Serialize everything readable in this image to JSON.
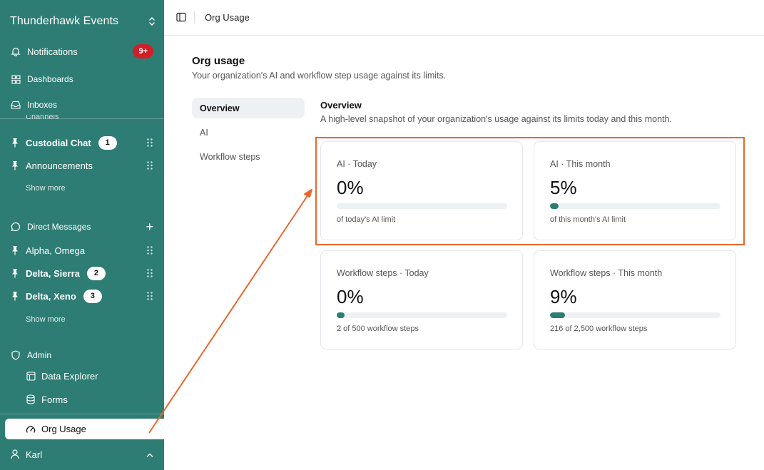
{
  "workspace": {
    "name": "Thunderhawk Events"
  },
  "nav": {
    "notifications": {
      "label": "Notifications",
      "badge": "9+"
    },
    "dashboards": {
      "label": "Dashboards"
    },
    "inboxes": {
      "label": "Inboxes"
    },
    "channels_label": "Channels"
  },
  "channels": {
    "items": [
      {
        "label": "Custodial Chat",
        "count": "1"
      },
      {
        "label": "Announcements"
      }
    ],
    "show_more": "Show more"
  },
  "direct_messages": {
    "label": "Direct Messages",
    "items": [
      {
        "label": "Alpha, Omega"
      },
      {
        "label": "Delta, Sierra",
        "count": "2"
      },
      {
        "label": "Delta, Xeno",
        "count": "3"
      }
    ],
    "show_more": "Show more"
  },
  "admin": {
    "label": "Admin",
    "items": [
      {
        "label": "Data Explorer"
      },
      {
        "label": "Forms"
      },
      {
        "label": "Org Usage"
      }
    ]
  },
  "user": {
    "name": "Karl"
  },
  "topbar": {
    "title": "Org Usage"
  },
  "page": {
    "title": "Org usage",
    "subtitle": "Your organization's AI and workflow step usage against its limits."
  },
  "tabs": [
    {
      "label": "Overview",
      "active": true
    },
    {
      "label": "AI"
    },
    {
      "label": "Workflow steps"
    }
  ],
  "overview": {
    "title": "Overview",
    "subtitle": "A high-level snapshot of your organization's usage against its limits today and this month."
  },
  "cards": [
    {
      "label": "AI · Today",
      "value": "0%",
      "progress": 0,
      "note": "of today's AI limit"
    },
    {
      "label": "AI · This month",
      "value": "5%",
      "progress": 0.05,
      "note": "of this month's AI limit"
    },
    {
      "label": "Workflow steps · Today",
      "value": "0%",
      "progress": 0.004,
      "note": "2 of 500 workflow steps"
    },
    {
      "label": "Workflow steps · This month",
      "value": "9%",
      "progress": 0.0864,
      "note": "216 of 2,500 workflow steps"
    }
  ],
  "colors": {
    "sidebar": "#2e7d74",
    "accent": "#2e7d74",
    "badge": "#d11f2a",
    "annotation": "#e8672c"
  },
  "icons": [
    "chevrons-updown-icon",
    "bell-icon",
    "grid-icon",
    "inbox-icon",
    "pin-icon",
    "drag-handle-icon",
    "chat-bubble-icon",
    "plus-icon",
    "shield-icon",
    "table-icon",
    "database-icon",
    "gauge-icon",
    "user-icon",
    "chevron-up-icon",
    "sidebar-toggle-icon"
  ]
}
